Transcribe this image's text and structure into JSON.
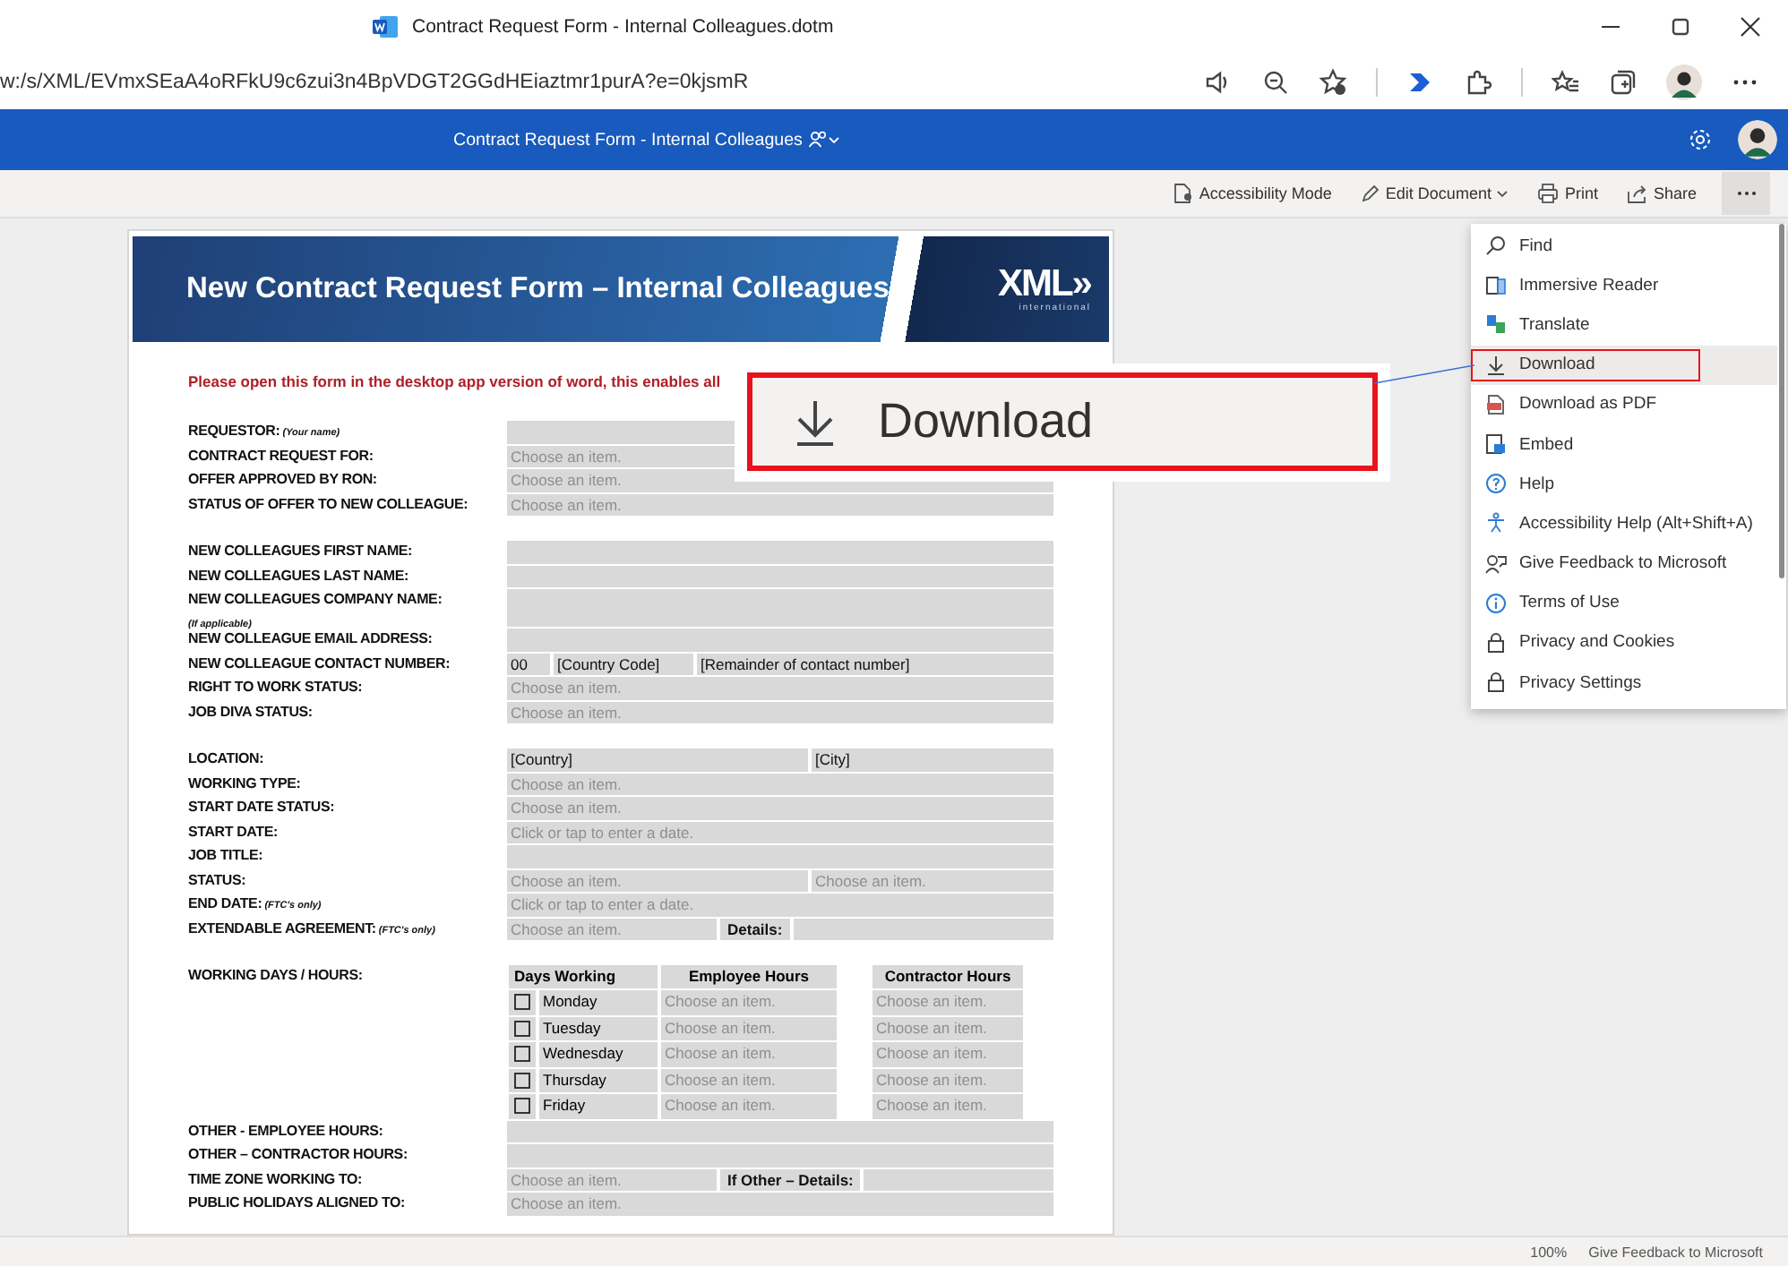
{
  "browser": {
    "title": "Contract Request Form - Internal Colleagues.dotm",
    "url": "w:/s/XML/EVmxSEaA4oRFkU9c6zui3n4BpVDGT2GGdHEiaztmr1purA?e=0kjsmR"
  },
  "app_bar": {
    "title": "Contract Request Form - Internal Colleagues"
  },
  "commands": [
    {
      "label": "Accessibility Mode",
      "dropdown": false
    },
    {
      "label": "Edit Document",
      "dropdown": true
    },
    {
      "label": "Print",
      "dropdown": false
    },
    {
      "label": "Share",
      "dropdown": false
    }
  ],
  "document": {
    "banner": {
      "title": "New Contract Request Form – Internal Colleagues",
      "logo": "XML»",
      "logo_subtitle": "international"
    },
    "notice": "Please open this form in the desktop app version of word, this enables all",
    "groups": [
      {
        "kind": "fields",
        "rows": [
          {
            "label": "REQUESTOR:",
            "note": "(Your name)",
            "kind": "single",
            "fields": [
              {
                "kind": "blank"
              }
            ]
          },
          {
            "label": "CONTRACT REQUEST FOR:",
            "kind": "single",
            "fields": [
              {
                "kind": "prompt",
                "text": "Choose an item."
              }
            ]
          },
          {
            "label": "OFFER APPROVED BY RON:",
            "kind": "single",
            "fields": [
              {
                "kind": "prompt",
                "text": "Choose an item."
              }
            ]
          },
          {
            "label": "STATUS OF OFFER TO NEW COLLEAGUE:",
            "kind": "single",
            "fields": [
              {
                "kind": "prompt",
                "text": "Choose an item."
              }
            ]
          }
        ]
      },
      {
        "kind": "fields",
        "rows": [
          {
            "label": "NEW COLLEAGUES FIRST NAME:",
            "kind": "single",
            "fields": [
              {
                "kind": "blank"
              }
            ]
          },
          {
            "label": "NEW COLLEAGUES LAST NAME:",
            "kind": "single",
            "fields": [
              {
                "kind": "blank"
              }
            ]
          },
          {
            "label": "NEW COLLEAGUES COMPANY NAME:",
            "subnote": "(If applicable)",
            "kind": "single",
            "fields": [
              {
                "kind": "blank"
              }
            ]
          },
          {
            "label": "NEW COLLEAGUE EMAIL ADDRESS:",
            "kind": "single",
            "fields": [
              {
                "kind": "blank"
              }
            ]
          },
          {
            "label": "NEW COLLEAGUE CONTACT NUMBER:",
            "kind": "phone",
            "fields": [
              {
                "kind": "value",
                "text": "00"
              },
              {
                "kind": "value",
                "text": "[Country Code]"
              },
              {
                "kind": "value",
                "text": "[Remainder of contact number]"
              }
            ]
          },
          {
            "label": "RIGHT TO WORK STATUS:",
            "kind": "single",
            "fields": [
              {
                "kind": "prompt",
                "text": "Choose an item."
              }
            ]
          },
          {
            "label": "JOB DIVA STATUS:",
            "kind": "single",
            "fields": [
              {
                "kind": "prompt",
                "text": "Choose an item."
              }
            ]
          }
        ]
      },
      {
        "kind": "fields",
        "rows": [
          {
            "label": "LOCATION:",
            "kind": "pair",
            "fields": [
              {
                "kind": "value",
                "text": "[Country]"
              },
              {
                "kind": "value",
                "text": "[City]"
              }
            ]
          },
          {
            "label": "WORKING TYPE:",
            "kind": "single",
            "fields": [
              {
                "kind": "prompt",
                "text": "Choose an item."
              }
            ]
          },
          {
            "label": "START DATE STATUS:",
            "kind": "single",
            "fields": [
              {
                "kind": "prompt",
                "text": "Choose an item."
              }
            ]
          },
          {
            "label": "START DATE:",
            "kind": "single",
            "fields": [
              {
                "kind": "prompt",
                "text": "Click or tap to enter a date."
              }
            ]
          },
          {
            "label": "JOB TITLE:",
            "kind": "single",
            "fields": [
              {
                "kind": "blank"
              }
            ]
          },
          {
            "label": "STATUS:",
            "kind": "pair",
            "fields": [
              {
                "kind": "prompt",
                "text": "Choose an item."
              },
              {
                "kind": "prompt",
                "text": "Choose an item."
              }
            ]
          },
          {
            "label": "END DATE:",
            "note": "(FTC's only)",
            "kind": "single",
            "fields": [
              {
                "kind": "prompt",
                "text": "Click or tap to enter a date."
              }
            ]
          },
          {
            "label": "EXTENDABLE AGREEMENT:",
            "note": "(FTC's only)",
            "kind": "detail",
            "fields": [
              {
                "kind": "prompt",
                "text": "Choose an item."
              },
              {
                "kind": "label",
                "text": "Details:"
              },
              {
                "kind": "blank"
              }
            ]
          }
        ]
      },
      {
        "kind": "hours",
        "label": "WORKING DAYS / HOURS:",
        "columns": [
          "Days Working",
          "Employee Hours",
          "Contractor Hours"
        ],
        "rows": [
          {
            "day": "Monday",
            "checked": false,
            "employee": "Choose an item.",
            "contractor": "Choose an item."
          },
          {
            "day": "Tuesday",
            "checked": false,
            "employee": "Choose an item.",
            "contractor": "Choose an item."
          },
          {
            "day": "Wednesday",
            "checked": false,
            "employee": "Choose an item.",
            "contractor": "Choose an item."
          },
          {
            "day": "Thursday",
            "checked": false,
            "employee": "Choose an item.",
            "contractor": "Choose an item."
          },
          {
            "day": "Friday",
            "checked": false,
            "employee": "Choose an item.",
            "contractor": "Choose an item."
          }
        ]
      },
      {
        "kind": "fields",
        "rows": [
          {
            "label": "OTHER - EMPLOYEE HOURS:",
            "kind": "single",
            "fields": [
              {
                "kind": "blank"
              }
            ]
          },
          {
            "label": "OTHER – CONTRACTOR HOURS:",
            "kind": "single",
            "fields": [
              {
                "kind": "blank"
              }
            ]
          },
          {
            "label": "TIME ZONE WORKING TO:",
            "kind": "detail",
            "fields": [
              {
                "kind": "prompt",
                "text": "Choose an item."
              },
              {
                "kind": "label",
                "text": "If Other – Details:"
              },
              {
                "kind": "blank"
              }
            ]
          },
          {
            "label": "PUBLIC HOLIDAYS ALIGNED TO:",
            "kind": "single",
            "fields": [
              {
                "kind": "prompt",
                "text": "Choose an item."
              }
            ]
          }
        ]
      }
    ]
  },
  "menu": {
    "items": [
      {
        "label": "Find",
        "selected": false,
        "annotated": false
      },
      {
        "label": "Immersive Reader",
        "selected": false,
        "annotated": false
      },
      {
        "label": "Translate",
        "selected": false,
        "annotated": false
      },
      {
        "label": "Download",
        "selected": true,
        "annotated": true
      },
      {
        "label": "Download as PDF",
        "selected": false,
        "annotated": false
      },
      {
        "label": "Embed",
        "selected": false,
        "annotated": false
      },
      {
        "label": "Help",
        "selected": false,
        "annotated": false
      },
      {
        "label": "Accessibility Help (Alt+Shift+A)",
        "selected": false,
        "annotated": false
      },
      {
        "label": "Give Feedback to Microsoft",
        "selected": false,
        "annotated": false
      },
      {
        "label": "Terms of Use",
        "selected": false,
        "annotated": false
      },
      {
        "label": "Privacy and Cookies",
        "selected": false,
        "annotated": false
      },
      {
        "label": "Privacy Settings",
        "selected": false,
        "annotated": false
      }
    ]
  },
  "callout": {
    "label": "Download"
  },
  "status_bar": {
    "zoom": "100%",
    "feedback": "Give Feedback to Microsoft"
  }
}
